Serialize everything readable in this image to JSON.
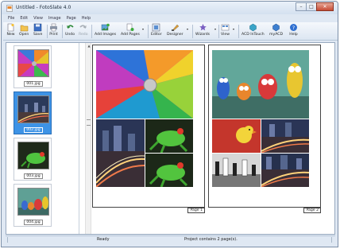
{
  "window": {
    "title": "Untitled - FotoSlate 4.0",
    "controls": {
      "minimize": "–",
      "maximize": "□",
      "close": "✕"
    }
  },
  "menu": [
    "File",
    "Edit",
    "View",
    "Image",
    "Page",
    "Help"
  ],
  "toolbar": {
    "new": "New",
    "open": "Open",
    "save": "Save",
    "print": "Print",
    "undo": "Undo",
    "redo": "Redo",
    "add_images": "Add Images",
    "add_pages": "Add Pages",
    "editor": "Editor",
    "designer": "Designer",
    "wizards": "Wizards",
    "view": "View",
    "acd_intouch": "ACD InTouch",
    "my_acd": "myACD",
    "help": "Help"
  },
  "sidebar": {
    "thumbnails": [
      {
        "label": "001.jpg",
        "selected": false
      },
      {
        "label": "002.jpg",
        "selected": true
      },
      {
        "label": "003.jpg",
        "selected": false
      },
      {
        "label": "004.jpg",
        "selected": false
      }
    ]
  },
  "pages": [
    {
      "label": "Page 1"
    },
    {
      "label": "Page 2"
    }
  ],
  "status": {
    "left": "Ready",
    "right": "Project contains 2 page(s)."
  },
  "colors": {
    "selection": "#3d93e6",
    "chrome": "#dfe8f3"
  }
}
